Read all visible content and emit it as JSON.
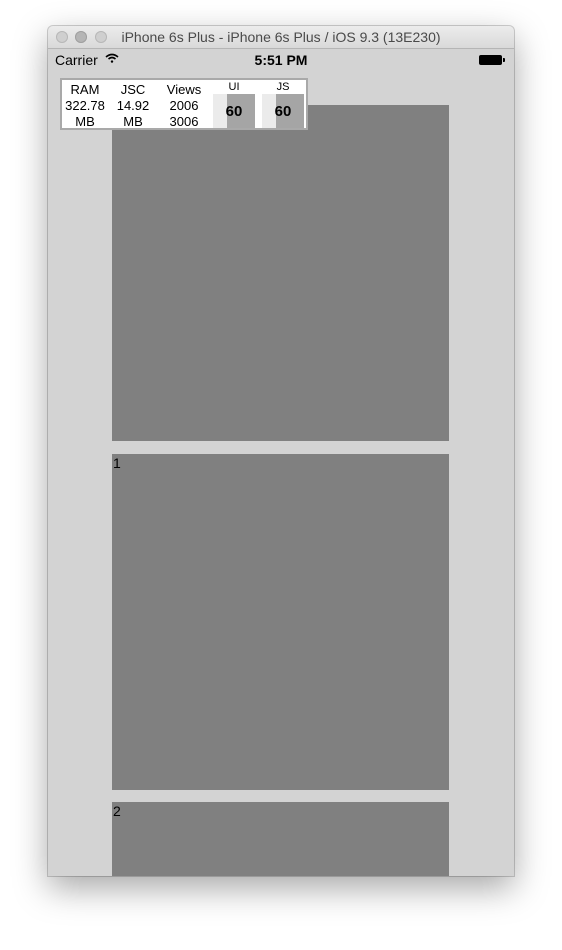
{
  "window": {
    "title": "iPhone 6s Plus - iPhone 6s Plus / iOS 9.3 (13E230)"
  },
  "statusbar": {
    "carrier": "Carrier",
    "time": "5:51 PM",
    "wifi_icon": "wifi-icon",
    "battery_icon": "battery-icon"
  },
  "perf_monitor": {
    "ram": {
      "label": "RAM",
      "value": "322.78",
      "unit": "MB"
    },
    "jsc": {
      "label": "JSC",
      "value": "14.92",
      "unit": "MB"
    },
    "views": {
      "label": "Views",
      "value1": "2006",
      "value2": "3006"
    },
    "ui": {
      "label": "UI",
      "fps": "60"
    },
    "js": {
      "label": "JS",
      "fps": "60"
    }
  },
  "cells": [
    {
      "label": ""
    },
    {
      "label": "1"
    },
    {
      "label": "2"
    }
  ],
  "colors": {
    "background": "#d3d3d3",
    "cell": "#808080"
  }
}
